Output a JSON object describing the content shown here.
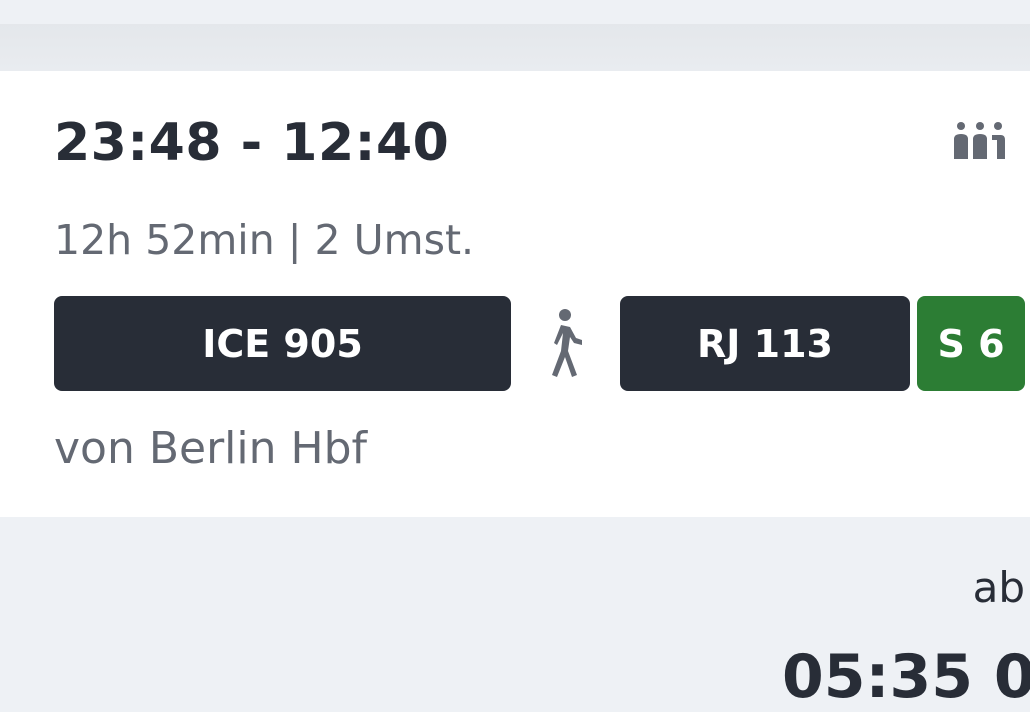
{
  "connection": {
    "times": "23:48 - 12:40",
    "meta": "12h 52min | 2 Umst.",
    "origin": "von Berlin Hbf",
    "occupancy_icon": "occupancy-people-icon",
    "segments": [
      {
        "label": "ICE 905",
        "color": "#282d37"
      },
      {
        "label": "RJ 113",
        "color": "#282d37"
      },
      {
        "label": "S 6",
        "color": "#2c7d34"
      }
    ],
    "transfer_icon": "walking-icon"
  },
  "next_connection": {
    "departure_prefix": "ab",
    "time_partial": "05:35 0"
  }
}
